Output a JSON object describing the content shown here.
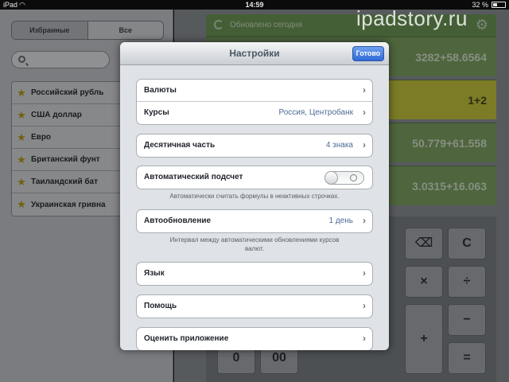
{
  "statusbar": {
    "device": "iPad",
    "time": "14:59",
    "battery": "32 %"
  },
  "watermark": "ipadstory.ru",
  "left_panel": {
    "tabs": [
      "Избранные",
      "Все"
    ],
    "favorites": [
      "Российский рубль",
      "США доллар",
      "Евро",
      "Британский фунт",
      "Таиландский бат",
      "Украинская гривна"
    ]
  },
  "right_panel": {
    "updated": "Обновлено сегодня",
    "rows": [
      "3282+58.6564",
      "1+2",
      "50.779+61.558",
      "3.0315+16.063"
    ],
    "keys": [
      "C",
      "×",
      "÷",
      "−",
      "+",
      "=",
      "0",
      "00"
    ]
  },
  "modal": {
    "title": "Настройки",
    "done": "Готово",
    "currencies": "Валюты",
    "rates_label": "Курсы",
    "rates_value": "Россия, Центробанк",
    "decimal_label": "Десятичная часть",
    "decimal_value": "4 знака",
    "autocalc_label": "Автоматический подсчет",
    "autocalc_note": "Автоматически считать формулы в неактивных строчках.",
    "autoupdate_label": "Автообновление",
    "autoupdate_value": "1 день",
    "autoupdate_note": "Интервал между автоматическими обновлениями курсов валют.",
    "language": "Язык",
    "help": "Помощь",
    "rate_app": "Оценить приложение"
  }
}
